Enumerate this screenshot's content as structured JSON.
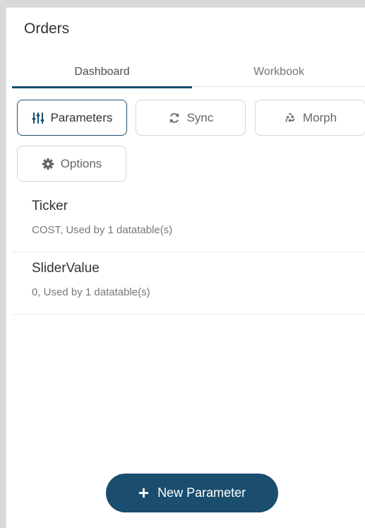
{
  "panel": {
    "title": "Orders"
  },
  "tabs": [
    {
      "label": "Dashboard",
      "active": true
    },
    {
      "label": "Workbook",
      "active": false
    }
  ],
  "toolbar": {
    "parameters_label": "Parameters",
    "sync_label": "Sync",
    "morph_label": "Morph",
    "options_label": "Options"
  },
  "parameters": [
    {
      "name": "Ticker",
      "description": "COST, Used by 1 datatable(s)"
    },
    {
      "name": "SliderValue",
      "description": "0, Used by 1 datatable(s)"
    }
  ],
  "footer": {
    "new_parameter_label": "New Parameter",
    "plus_glyph": "+"
  },
  "colors": {
    "accent": "#1a4d6e",
    "background": "#d9d9d9",
    "panel": "#ffffff"
  },
  "icons": {
    "parameters": "sliders-icon",
    "sync": "sync-icon",
    "morph": "recycle-icon",
    "options": "gear-icon",
    "new_parameter": "plus-icon"
  }
}
